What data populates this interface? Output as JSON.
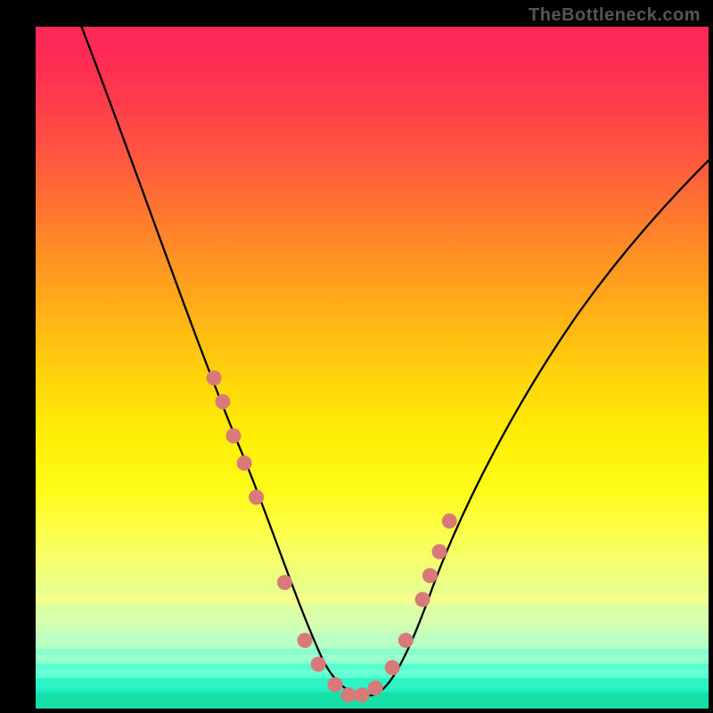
{
  "watermark": "TheBottleneck.com",
  "colors": {
    "frame": "#000000",
    "watermark": "#555555",
    "curve": "#000000",
    "points": "#d97a7a"
  },
  "chart_data": {
    "type": "line",
    "title": "",
    "xlabel": "",
    "ylabel": "",
    "xlim": [
      0,
      100
    ],
    "ylim": [
      0,
      100
    ],
    "series": [
      {
        "name": "bottleneck-curve",
        "x": [
          0,
          4,
          8,
          12,
          16,
          20,
          24,
          28,
          30,
          32,
          34,
          36,
          38,
          40,
          42,
          44,
          46,
          48,
          50,
          52,
          56,
          60,
          64,
          68,
          72,
          76,
          80,
          84,
          88,
          92,
          96,
          100
        ],
        "y": [
          104,
          96,
          88,
          80,
          71,
          62,
          53,
          44,
          39,
          34,
          29,
          24,
          19,
          14,
          10,
          6,
          3,
          1.5,
          2,
          4,
          9,
          15,
          21,
          27,
          33,
          38,
          43,
          48,
          52,
          56,
          60,
          64
        ]
      }
    ],
    "points": {
      "name": "sample-points",
      "x": [
        26.5,
        27.8,
        29.4,
        31.0,
        32.8,
        37.0,
        40.0,
        42.0,
        44.5,
        46.5,
        48.5,
        50.5,
        53.0,
        55.0,
        57.5,
        58.6,
        60.0,
        61.5
      ],
      "y": [
        48.5,
        45.0,
        40.0,
        36.0,
        31.0,
        18.5,
        10.0,
        6.5,
        3.5,
        2.0,
        2.0,
        3.0,
        6.0,
        10.0,
        16.0,
        19.5,
        23.0,
        27.5
      ]
    },
    "gradient_stops": [
      {
        "pct": 0,
        "color": "#ff2a55"
      },
      {
        "pct": 20,
        "color": "#ff7a2e"
      },
      {
        "pct": 40,
        "color": "#ffb814"
      },
      {
        "pct": 60,
        "color": "#ffee06"
      },
      {
        "pct": 80,
        "color": "#e0ffa0"
      },
      {
        "pct": 95,
        "color": "#48ffd2"
      },
      {
        "pct": 100,
        "color": "#14e0a8"
      }
    ]
  }
}
